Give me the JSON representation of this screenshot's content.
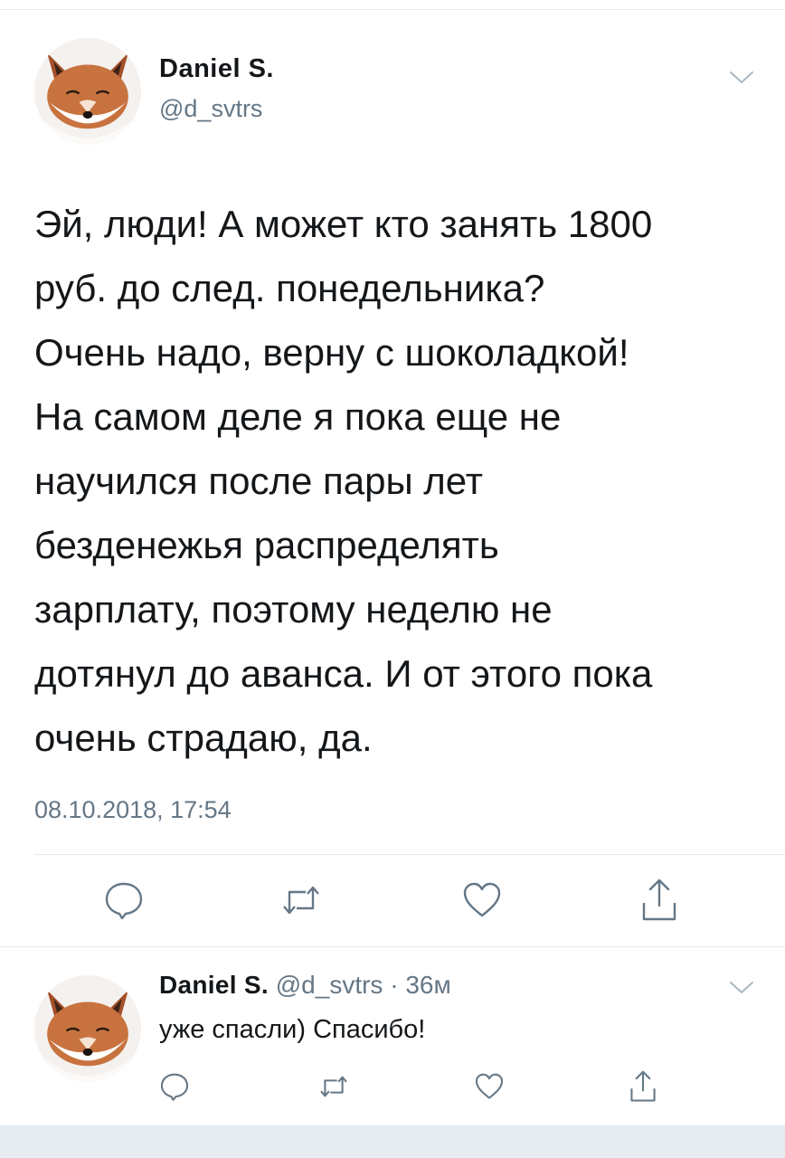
{
  "tweet": {
    "author_name": "Daniel S.",
    "author_handle": "@d_svtrs",
    "avatar_icon": "fox-avatar",
    "text_lines": [
      "Эй, люди! А может кто занять 1800",
      "руб. до след. понедельника?",
      "Очень надо, верну с шоколадкой!",
      "На самом деле я пока еще не",
      "научился после пары лет",
      "безденежья распределять",
      "зарплату, поэтому неделю не",
      "дотянул до аванса. И от этого пока",
      "очень страдаю, да."
    ],
    "timestamp": "08.10.2018, 17:54",
    "actions": [
      "reply-icon",
      "retweet-icon",
      "like-icon",
      "share-icon"
    ]
  },
  "reply": {
    "author_name": "Daniel S.",
    "author_handle": "@d_svtrs",
    "separator": "·",
    "time": "36м",
    "text": "уже спасли) Спасибо!",
    "avatar_icon": "fox-avatar",
    "actions": [
      "reply-icon",
      "retweet-icon",
      "like-icon",
      "share-icon"
    ]
  },
  "colors": {
    "text": "#14171a",
    "secondary": "#657786",
    "divider": "#e1e8ed",
    "background": "#ffffff",
    "bottom_bar": "#e6ecf0"
  }
}
